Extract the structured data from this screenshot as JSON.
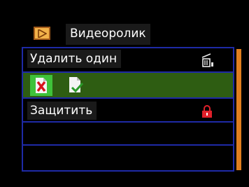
{
  "header": {
    "title": "Видеоролик",
    "icon": "video-play-icon"
  },
  "menu": {
    "items": [
      {
        "label": "Удалить один",
        "icon": "trash-icon"
      },
      {
        "label": "",
        "icons": [
          "file-delete-icon",
          "file-check-icon"
        ],
        "selected": true
      },
      {
        "label": "Защитить",
        "icon": "lock-icon"
      },
      {
        "label": ""
      },
      {
        "label": ""
      }
    ]
  },
  "colors": {
    "accent": "#e07e1e",
    "panel_border": "#1e2aa6",
    "selected_row": "#2e5d12",
    "selected_icon_bg": "#3fc23a",
    "lock_red": "#e0202a"
  }
}
